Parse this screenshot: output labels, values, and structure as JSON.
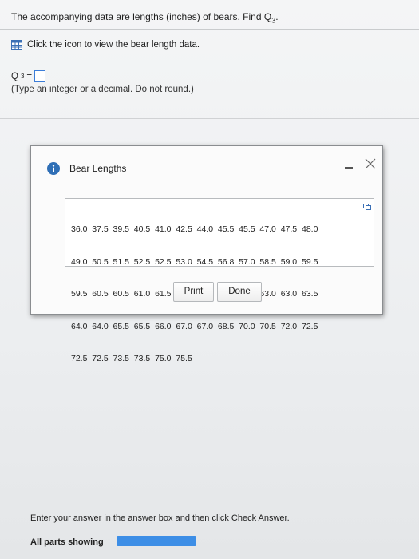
{
  "question": {
    "text": "The accompanying data are lengths (inches) of bears. Find Q",
    "subscript": "3",
    "suffix": "."
  },
  "data_link": {
    "icon": "table-icon",
    "label": "Click the icon to view the bear length data."
  },
  "answer": {
    "variable": "Q",
    "subscript": "3",
    "equals": "=",
    "value": ""
  },
  "hint": "(Type an integer or a decimal. Do not round.)",
  "dialog": {
    "icon": "info-icon",
    "title": "Bear Lengths",
    "rows": [
      "36.0  37.5  39.5  40.5  41.0  42.5  44.0  45.5  45.5  47.0  47.5  48.0",
      "49.0  50.5  51.5  52.5  52.5  53.0  54.5  56.8  57.0  58.5  59.0  59.5",
      "59.5  60.5  60.5  61.0  61.5  61.5  62.0  62.5  62.5  63.0  63.0  63.5",
      "64.0  64.0  65.5  65.5  66.0  67.0  67.0  68.5  70.0  70.5  72.0  72.5",
      "72.5  72.5  73.5  73.5  75.0  75.5"
    ],
    "print_label": "Print",
    "done_label": "Done"
  },
  "footer": {
    "instruction": "Enter your answer in the answer box and then click Check Answer.",
    "parts_label": "All parts showing",
    "progress_fraction": 1.0,
    "accent": "#3d8ee6"
  }
}
